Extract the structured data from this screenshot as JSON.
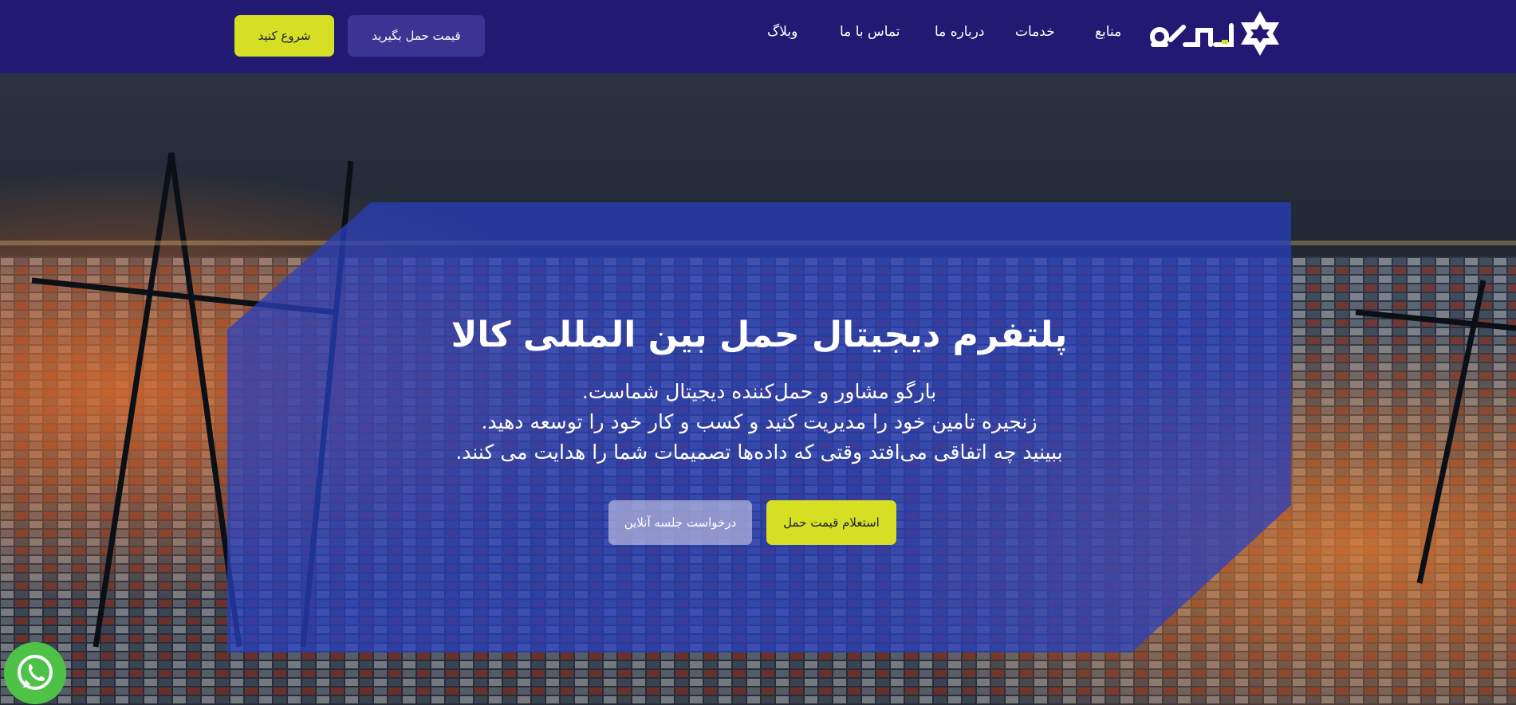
{
  "header": {
    "logo_text": "بارگو",
    "nav": [
      "منابع",
      "خدمات",
      "درباره ما",
      "تماس با ما",
      "وبلاگ"
    ],
    "quote_button": "قیمت حمل بگیرید",
    "start_button": "شروع کنید"
  },
  "hero": {
    "title": "پلتفرم دیجیتال حمل بین المللی کالا",
    "lines": [
      "بارگو مشاور و حمل‌کننده دیجیتال شماست.",
      "زنجیره تامین خود را مدیریت کنید و کسب و کار خود را توسعه دهید.",
      "ببینید چه اتفاقی می‌افتد وقتی که داده‌ها تصمیمات شما را هدایت می کنند."
    ],
    "primary_button": "استعلام قیمت حمل",
    "secondary_button": "درخواست جلسه آنلاین"
  },
  "floating": {
    "whatsapp_icon": "whatsapp-icon"
  },
  "colors": {
    "header_bg": "#221a72",
    "accent_yellow": "#d6df24",
    "panel_blue": "#2840be",
    "whatsapp_green": "#4dc247"
  }
}
